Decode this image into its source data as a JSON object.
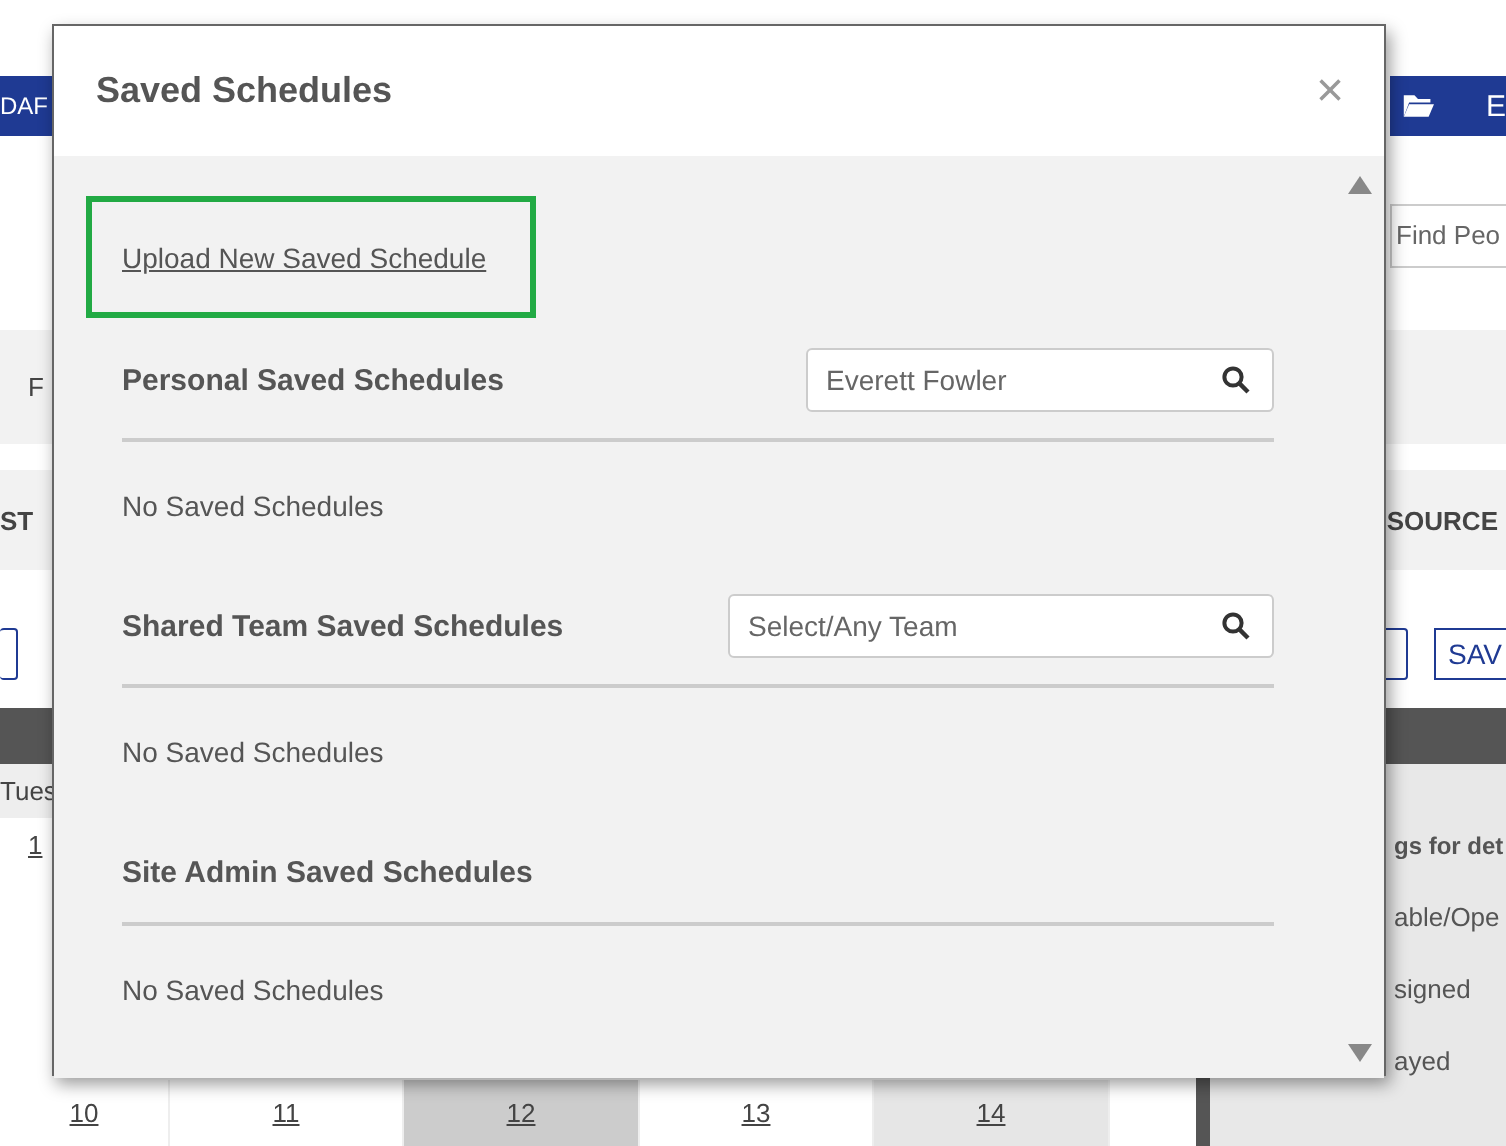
{
  "background": {
    "header_left": "DAF",
    "header_right": "E",
    "people_search": {
      "placeholder": "Find Peo"
    },
    "filter_label": "F",
    "column_left": "ST",
    "column_right": "SOURCE",
    "save_button": "SAV",
    "day_header": "Tues",
    "day_number": "1",
    "legend": [
      "gs for det",
      "able/Ope",
      "signed",
      "ayed"
    ],
    "dates": [
      {
        "label": "10",
        "kind": "plain"
      },
      {
        "label": "11",
        "kind": "plain"
      },
      {
        "label": "12",
        "kind": "current"
      },
      {
        "label": "13",
        "kind": "plain"
      },
      {
        "label": "14",
        "kind": "muted"
      }
    ]
  },
  "modal": {
    "title": "Saved Schedules",
    "close": "×",
    "upload_link": {
      "label": "Upload New Saved Schedule",
      "highlighted": true
    },
    "sections": [
      {
        "title": "Personal Saved Schedules",
        "search": {
          "value": "Everett Fowler"
        },
        "empty_text": "No Saved Schedules"
      },
      {
        "title": "Shared Team Saved Schedules",
        "search": {
          "placeholder": "Select/Any Team"
        },
        "empty_text": "No Saved Schedules"
      },
      {
        "title": "Site Admin Saved Schedules",
        "empty_text": "No Saved Schedules"
      }
    ]
  }
}
